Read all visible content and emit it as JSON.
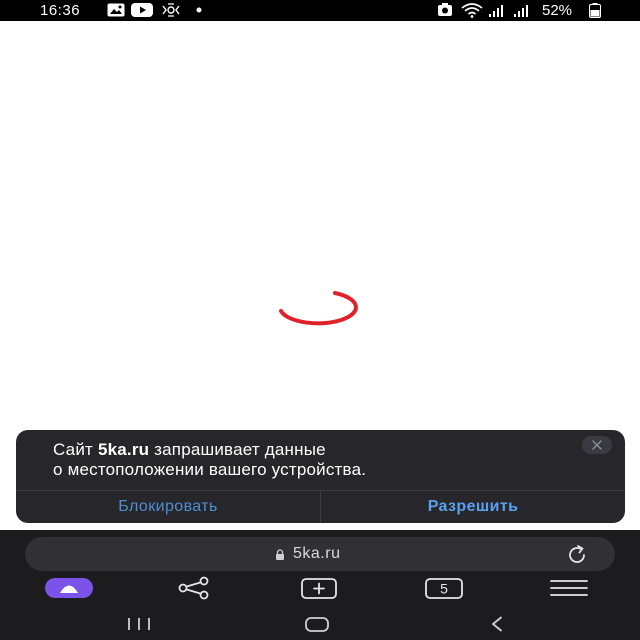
{
  "status_bar": {
    "time": "16:36",
    "battery_percent": "52%"
  },
  "dialog": {
    "message_prefix": "Сайт ",
    "site": "5ka.ru",
    "message_suffix_line1": " запрашивает данные",
    "message_line2": "о местоположении вашего устройства.",
    "block_label": "Блокировать",
    "allow_label": "Разрешить"
  },
  "browser": {
    "url": "5ka.ru",
    "tab_count": "5"
  },
  "colors": {
    "spinner": "#e0232b",
    "alice_button": "#7b53e8",
    "allow_text": "#5aa0ec",
    "block_text": "#4e8fd1"
  },
  "icons": {
    "status": [
      "gallery-icon",
      "youtube-icon",
      "tiktok-icon",
      "dot-icon",
      "screenshot-icon",
      "wifi-icon",
      "signal-icon",
      "battery-icon"
    ],
    "toolbar": [
      "alice-icon",
      "share-icon",
      "new-tab-icon",
      "tabs-icon",
      "menu-icon"
    ],
    "system_nav": [
      "recents-icon",
      "home-icon",
      "back-icon"
    ]
  }
}
